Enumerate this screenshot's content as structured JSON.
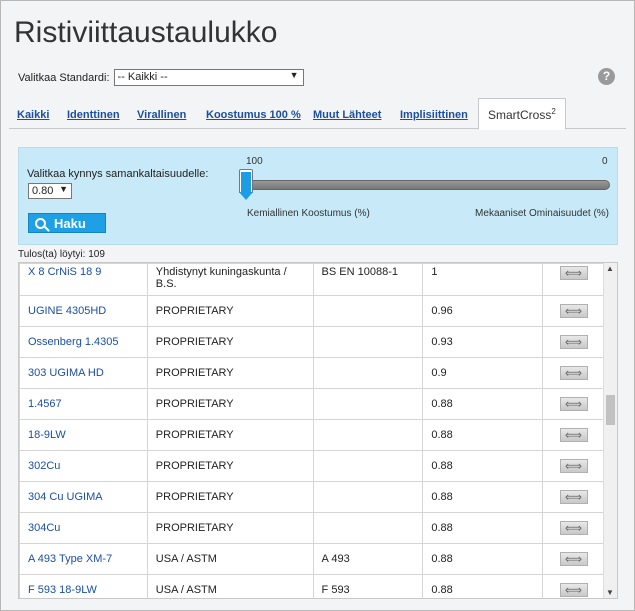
{
  "page": {
    "title": "Ristiviittaustaulukko"
  },
  "standard": {
    "label": "Valitkaa Standardi:",
    "selected": "-- Kaikki --"
  },
  "help": {
    "glyph": "?"
  },
  "tabs": [
    {
      "label": "Kaikki"
    },
    {
      "label": "Identtinen"
    },
    {
      "label": "Virallinen"
    },
    {
      "label": "Koostumus 100 %"
    },
    {
      "label": "Muut Lähteet"
    },
    {
      "label": "Implisiittinen"
    },
    {
      "label": "SmartCross",
      "sup": "2",
      "active": true
    }
  ],
  "threshold": {
    "label": "Valitkaa kynnys samankaltaisuudelle:",
    "selected": "0.80",
    "search_label": "Haku"
  },
  "slider": {
    "left_value": "100",
    "right_value": "0",
    "left_label": "Kemiallinen Koostumus (%)",
    "right_label": "Mekaaniset Ominaisuudet (%)",
    "position": 1.0
  },
  "results": {
    "count_text": "Tulos(ta) löytyi: 109"
  },
  "rows": [
    {
      "name": "X 8 CrNiS 18 9",
      "country": "Yhdistynyt kuningaskunta / B.S.",
      "standard": "BS EN 10088-1",
      "similarity": "1"
    },
    {
      "name": "UGINE 4305HD",
      "country": "PROPRIETARY",
      "standard": "",
      "similarity": "0.96"
    },
    {
      "name": "Ossenberg 1.4305",
      "country": "PROPRIETARY",
      "standard": "",
      "similarity": "0.93"
    },
    {
      "name": "303 UGIMA HD",
      "country": "PROPRIETARY",
      "standard": "",
      "similarity": "0.9"
    },
    {
      "name": "1.4567",
      "country": "PROPRIETARY",
      "standard": "",
      "similarity": "0.88"
    },
    {
      "name": "18-9LW",
      "country": "PROPRIETARY",
      "standard": "",
      "similarity": "0.88"
    },
    {
      "name": "302Cu",
      "country": "PROPRIETARY",
      "standard": "",
      "similarity": "0.88"
    },
    {
      "name": "304 Cu UGIMA",
      "country": "PROPRIETARY",
      "standard": "",
      "similarity": "0.88"
    },
    {
      "name": "304Cu",
      "country": "PROPRIETARY",
      "standard": "",
      "similarity": "0.88"
    },
    {
      "name": "A 493 Type XM-7",
      "country": "USA / ASTM",
      "standard": "A 493",
      "similarity": "0.88"
    },
    {
      "name": "F 593 18-9LW",
      "country": "USA / ASTM",
      "standard": "F 593",
      "similarity": "0.88"
    }
  ],
  "colors": {
    "accent": "#1ea0e6",
    "panel": "#c7e9f8",
    "link": "#1b4fa0"
  }
}
